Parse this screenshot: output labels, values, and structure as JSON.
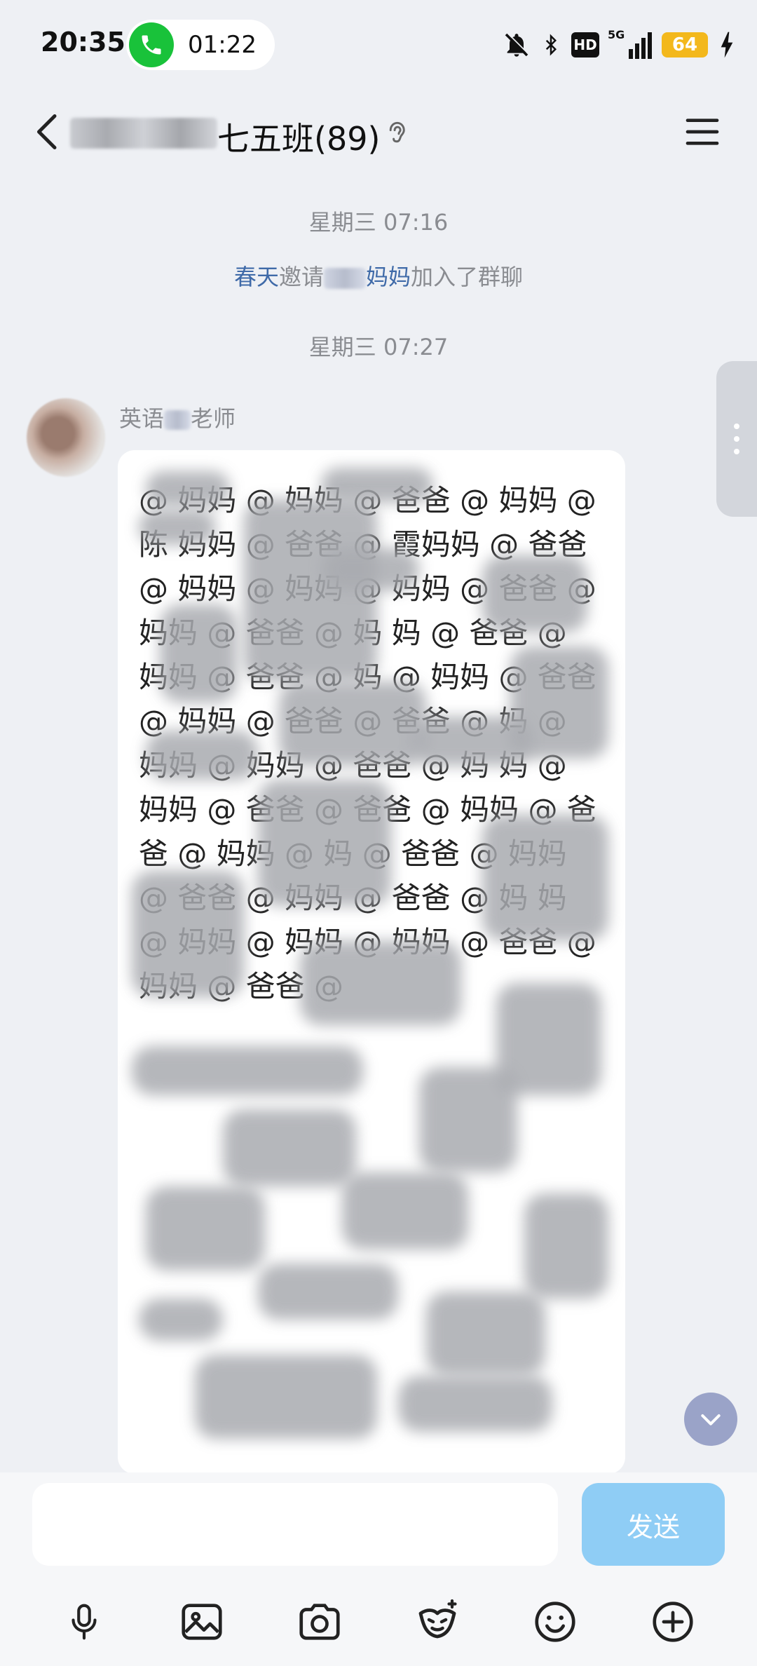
{
  "status_bar": {
    "time": "20:35",
    "call_duration": "01:22",
    "hd_label": "HD",
    "network_label": "5G",
    "battery_level": "64",
    "colors": {
      "call_green": "#19c23a",
      "battery": "#f3b81c"
    },
    "icons": [
      "phone-icon",
      "bell-off-icon",
      "bluetooth-icon",
      "signal-icon",
      "charging-icon"
    ]
  },
  "header": {
    "title_suffix": "七五班(89)",
    "icons": [
      "back-arrow-icon",
      "ear-icon",
      "menu-icon"
    ]
  },
  "chat": {
    "timestamp_1": "星期三 07:16",
    "notice": {
      "inviter": "春天",
      "invite_verb": "邀请",
      "invitee_suffix": "妈妈",
      "tail": "加入了群聊"
    },
    "timestamp_2": "星期三 07:27",
    "message": {
      "sender_prefix": "英语",
      "sender_suffix": "老师",
      "text": "@ 妈妈 @ 妈妈 @ 爸爸 @ 妈妈 @陈 妈妈 @ 爸爸 @ 霞妈妈 @ 爸爸 @ 妈妈 @ 妈妈 @ 妈妈 @ 爸爸 @ 妈妈 @ 爸爸 @ 妈 妈 @ 爸爸 @ 妈妈 @ 爸爸 @ 妈 @ 妈妈 @ 爸爸 @ 妈妈 @ 爸爸 @ 爸爸 @ 妈 @ 妈妈 @ 妈妈 @ 爸爸 @ 妈 妈 @ 妈妈 @ 爸爸 @ 爸爸 @ 妈妈 @ 爸爸 @ 妈妈 @ 妈 @ 爸爸 @ 妈妈 @ 爸爸 @ 妈妈 @ 爸爸 @ 妈 妈 @ 妈妈 @ 妈妈 @ 妈妈 @ 爸爸 @ 妈妈 @ 爸爸 @"
    }
  },
  "input": {
    "placeholder": "",
    "send_label": "发送",
    "send_color": "#8fcdf5"
  },
  "toolbar_icons": [
    "microphone-icon",
    "image-icon",
    "camera-icon",
    "sticker-icon",
    "emoji-icon",
    "plus-icon"
  ]
}
